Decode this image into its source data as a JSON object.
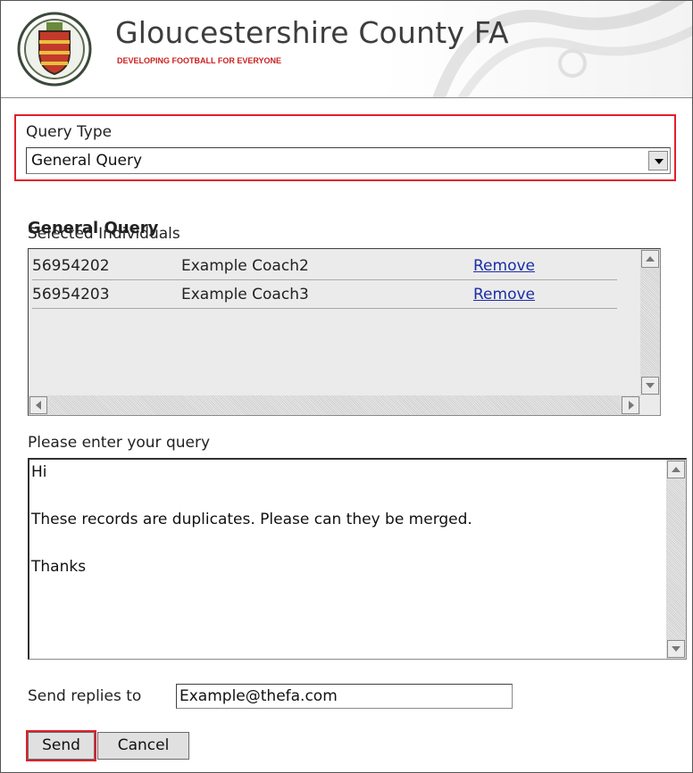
{
  "header": {
    "title": "Gloucestershire County FA",
    "tagline": "DEVELOPING FOOTBALL FOR EVERYONE"
  },
  "query_type": {
    "label": "Query Type",
    "selected": "General Query"
  },
  "section_title": "General Query",
  "individuals": {
    "label": "Selected Individuals",
    "rows": [
      {
        "id": "56954202",
        "name": "Example Coach2",
        "action": "Remove"
      },
      {
        "id": "56954203",
        "name": "Example Coach3",
        "action": "Remove"
      }
    ]
  },
  "query": {
    "label": "Please enter your query",
    "lines": [
      "Hi",
      "These records are duplicates. Please can they be merged.",
      "Thanks"
    ]
  },
  "replies": {
    "label": "Send replies to",
    "value": "Example@thefa.com"
  },
  "buttons": {
    "send": "Send",
    "cancel": "Cancel"
  },
  "colors": {
    "highlight": "#e0202a",
    "link": "#1a2ea6",
    "tagline": "#cc1f1f"
  }
}
